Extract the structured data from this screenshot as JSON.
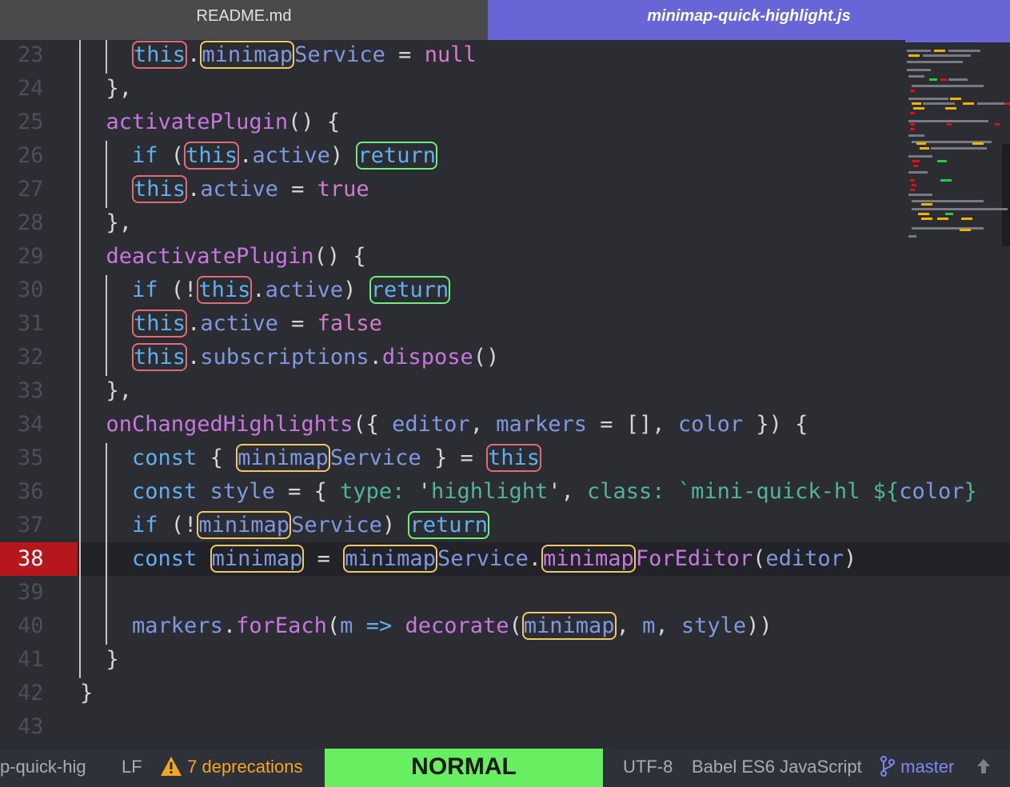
{
  "tabs": [
    {
      "label": "README.md",
      "active": false
    },
    {
      "label": "minimap-quick-highlight.js",
      "active": true
    }
  ],
  "editor": {
    "current_line": 38,
    "lines": [
      {
        "n": "23",
        "tokens": [
          {
            "t": "    "
          },
          {
            "t": "this",
            "c": "kw",
            "h": "r"
          },
          {
            "t": ".",
            "c": "pl"
          },
          {
            "t": "minimap",
            "c": "prop",
            "h": "y"
          },
          {
            "t": "Service",
            "c": "prop"
          },
          {
            "t": " = ",
            "c": "pl"
          },
          {
            "t": "null",
            "c": "lit"
          }
        ]
      },
      {
        "n": "24",
        "tokens": [
          {
            "t": "  "
          },
          {
            "t": "},",
            "c": "pl"
          }
        ]
      },
      {
        "n": "25",
        "tokens": [
          {
            "t": "  "
          },
          {
            "t": "activatePlugin",
            "c": "fn"
          },
          {
            "t": "() {",
            "c": "pl"
          }
        ]
      },
      {
        "n": "26",
        "tokens": [
          {
            "t": "    "
          },
          {
            "t": "if",
            "c": "kw"
          },
          {
            "t": " (",
            "c": "pl"
          },
          {
            "t": "this",
            "c": "kw",
            "h": "r"
          },
          {
            "t": ".",
            "c": "pl"
          },
          {
            "t": "active",
            "c": "prop"
          },
          {
            "t": ") ",
            "c": "pl"
          },
          {
            "t": "return",
            "c": "kw",
            "h": "g"
          }
        ]
      },
      {
        "n": "27",
        "tokens": [
          {
            "t": "    "
          },
          {
            "t": "this",
            "c": "kw",
            "h": "r"
          },
          {
            "t": ".",
            "c": "pl"
          },
          {
            "t": "active",
            "c": "prop"
          },
          {
            "t": " = ",
            "c": "pl"
          },
          {
            "t": "true",
            "c": "lit"
          }
        ]
      },
      {
        "n": "28",
        "tokens": [
          {
            "t": "  "
          },
          {
            "t": "},",
            "c": "pl"
          }
        ]
      },
      {
        "n": "29",
        "tokens": [
          {
            "t": "  "
          },
          {
            "t": "deactivatePlugin",
            "c": "fn"
          },
          {
            "t": "() {",
            "c": "pl"
          }
        ]
      },
      {
        "n": "30",
        "tokens": [
          {
            "t": "    "
          },
          {
            "t": "if",
            "c": "kw"
          },
          {
            "t": " (!",
            "c": "pl"
          },
          {
            "t": "this",
            "c": "kw",
            "h": "r"
          },
          {
            "t": ".",
            "c": "pl"
          },
          {
            "t": "active",
            "c": "prop"
          },
          {
            "t": ") ",
            "c": "pl"
          },
          {
            "t": "return",
            "c": "kw",
            "h": "g"
          }
        ]
      },
      {
        "n": "31",
        "tokens": [
          {
            "t": "    "
          },
          {
            "t": "this",
            "c": "kw",
            "h": "r"
          },
          {
            "t": ".",
            "c": "pl"
          },
          {
            "t": "active",
            "c": "prop"
          },
          {
            "t": " = ",
            "c": "pl"
          },
          {
            "t": "false",
            "c": "lit"
          }
        ]
      },
      {
        "n": "32",
        "tokens": [
          {
            "t": "    "
          },
          {
            "t": "this",
            "c": "kw",
            "h": "r"
          },
          {
            "t": ".",
            "c": "pl"
          },
          {
            "t": "subscriptions",
            "c": "prop"
          },
          {
            "t": ".",
            "c": "pl"
          },
          {
            "t": "dispose",
            "c": "fn"
          },
          {
            "t": "()",
            "c": "pl"
          }
        ]
      },
      {
        "n": "33",
        "tokens": [
          {
            "t": "  "
          },
          {
            "t": "},",
            "c": "pl"
          }
        ]
      },
      {
        "n": "34",
        "tokens": [
          {
            "t": "  "
          },
          {
            "t": "onChangedHighlights",
            "c": "fn"
          },
          {
            "t": "({ ",
            "c": "pl"
          },
          {
            "t": "editor",
            "c": "prop"
          },
          {
            "t": ", ",
            "c": "pl"
          },
          {
            "t": "markers",
            "c": "prop"
          },
          {
            "t": " = [], ",
            "c": "pl"
          },
          {
            "t": "color",
            "c": "prop"
          },
          {
            "t": " }) {",
            "c": "pl"
          }
        ]
      },
      {
        "n": "35",
        "tokens": [
          {
            "t": "    "
          },
          {
            "t": "const",
            "c": "kw"
          },
          {
            "t": " { ",
            "c": "pl"
          },
          {
            "t": "minimap",
            "c": "prop",
            "h": "y"
          },
          {
            "t": "Service",
            "c": "prop"
          },
          {
            "t": " } = ",
            "c": "pl"
          },
          {
            "t": "this",
            "c": "kw",
            "h": "r"
          }
        ]
      },
      {
        "n": "36",
        "tokens": [
          {
            "t": "    "
          },
          {
            "t": "const",
            "c": "kw"
          },
          {
            "t": " ",
            "c": "pl"
          },
          {
            "t": "style",
            "c": "prop"
          },
          {
            "t": " = { ",
            "c": "pl"
          },
          {
            "t": "type:",
            "c": "str"
          },
          {
            "t": " '",
            "c": "pl"
          },
          {
            "t": "highlight",
            "c": "str"
          },
          {
            "t": "', ",
            "c": "pl"
          },
          {
            "t": "class:",
            "c": "str"
          },
          {
            "t": " `mini-quick-hl ${",
            "c": "str"
          },
          {
            "t": "color",
            "c": "prop"
          },
          {
            "t": "}",
            "c": "str"
          }
        ]
      },
      {
        "n": "37",
        "tokens": [
          {
            "t": "    "
          },
          {
            "t": "if",
            "c": "kw"
          },
          {
            "t": " (!",
            "c": "pl"
          },
          {
            "t": "minimap",
            "c": "prop",
            "h": "y"
          },
          {
            "t": "Service",
            "c": "prop"
          },
          {
            "t": ") ",
            "c": "pl"
          },
          {
            "t": "return",
            "c": "kw",
            "h": "g"
          }
        ]
      },
      {
        "n": "38",
        "tokens": [
          {
            "t": "    "
          },
          {
            "t": "const",
            "c": "kw"
          },
          {
            "t": " ",
            "c": "pl"
          },
          {
            "t": "minimap",
            "c": "prop",
            "h": "y"
          },
          {
            "t": " = ",
            "c": "pl"
          },
          {
            "t": "minimap",
            "c": "prop",
            "h": "y"
          },
          {
            "t": "Service",
            "c": "prop"
          },
          {
            "t": ".",
            "c": "pl"
          },
          {
            "t": "minimap",
            "c": "fn",
            "h": "y"
          },
          {
            "t": "ForEditor",
            "c": "fn"
          },
          {
            "t": "(",
            "c": "pl"
          },
          {
            "t": "editor",
            "c": "prop"
          },
          {
            "t": ")",
            "c": "pl"
          }
        ]
      },
      {
        "n": "39",
        "tokens": []
      },
      {
        "n": "40",
        "tokens": [
          {
            "t": "    "
          },
          {
            "t": "markers",
            "c": "prop"
          },
          {
            "t": ".",
            "c": "pl"
          },
          {
            "t": "forEach",
            "c": "fn"
          },
          {
            "t": "(",
            "c": "pl"
          },
          {
            "t": "m",
            "c": "prop"
          },
          {
            "t": " ",
            "c": "pl"
          },
          {
            "t": "=>",
            "c": "kw"
          },
          {
            "t": " ",
            "c": "pl"
          },
          {
            "t": "decorate",
            "c": "fn"
          },
          {
            "t": "(",
            "c": "pl"
          },
          {
            "t": "minimap",
            "c": "prop",
            "h": "y"
          },
          {
            "t": ", ",
            "c": "pl"
          },
          {
            "t": "m",
            "c": "prop"
          },
          {
            "t": ", ",
            "c": "pl"
          },
          {
            "t": "style",
            "c": "prop"
          },
          {
            "t": "))",
            "c": "pl"
          }
        ]
      },
      {
        "n": "41",
        "tokens": [
          {
            "t": "  "
          },
          {
            "t": "}",
            "c": "pl"
          }
        ]
      },
      {
        "n": "42",
        "tokens": [
          {
            "t": "}",
            "c": "pl"
          }
        ]
      },
      {
        "n": "43",
        "tokens": []
      }
    ]
  },
  "statusbar": {
    "file": "p-quick-hig",
    "line_ending": "LF",
    "warning_icon": "warning-triangle-icon",
    "deprecations": "7 deprecations",
    "mode": "NORMAL",
    "encoding": "UTF-8",
    "grammar": "Babel ES6 JavaScript",
    "branch_icon": "git-branch-icon",
    "branch": "master",
    "push_icon": "arrow-up-icon"
  },
  "colors": {
    "accent": "#6866d6",
    "current_line": "#b5171c",
    "mode_bg": "#67ee61",
    "highlight_red": "#e06c75",
    "highlight_yellow": "#f0c864",
    "highlight_green": "#6cf07a"
  }
}
